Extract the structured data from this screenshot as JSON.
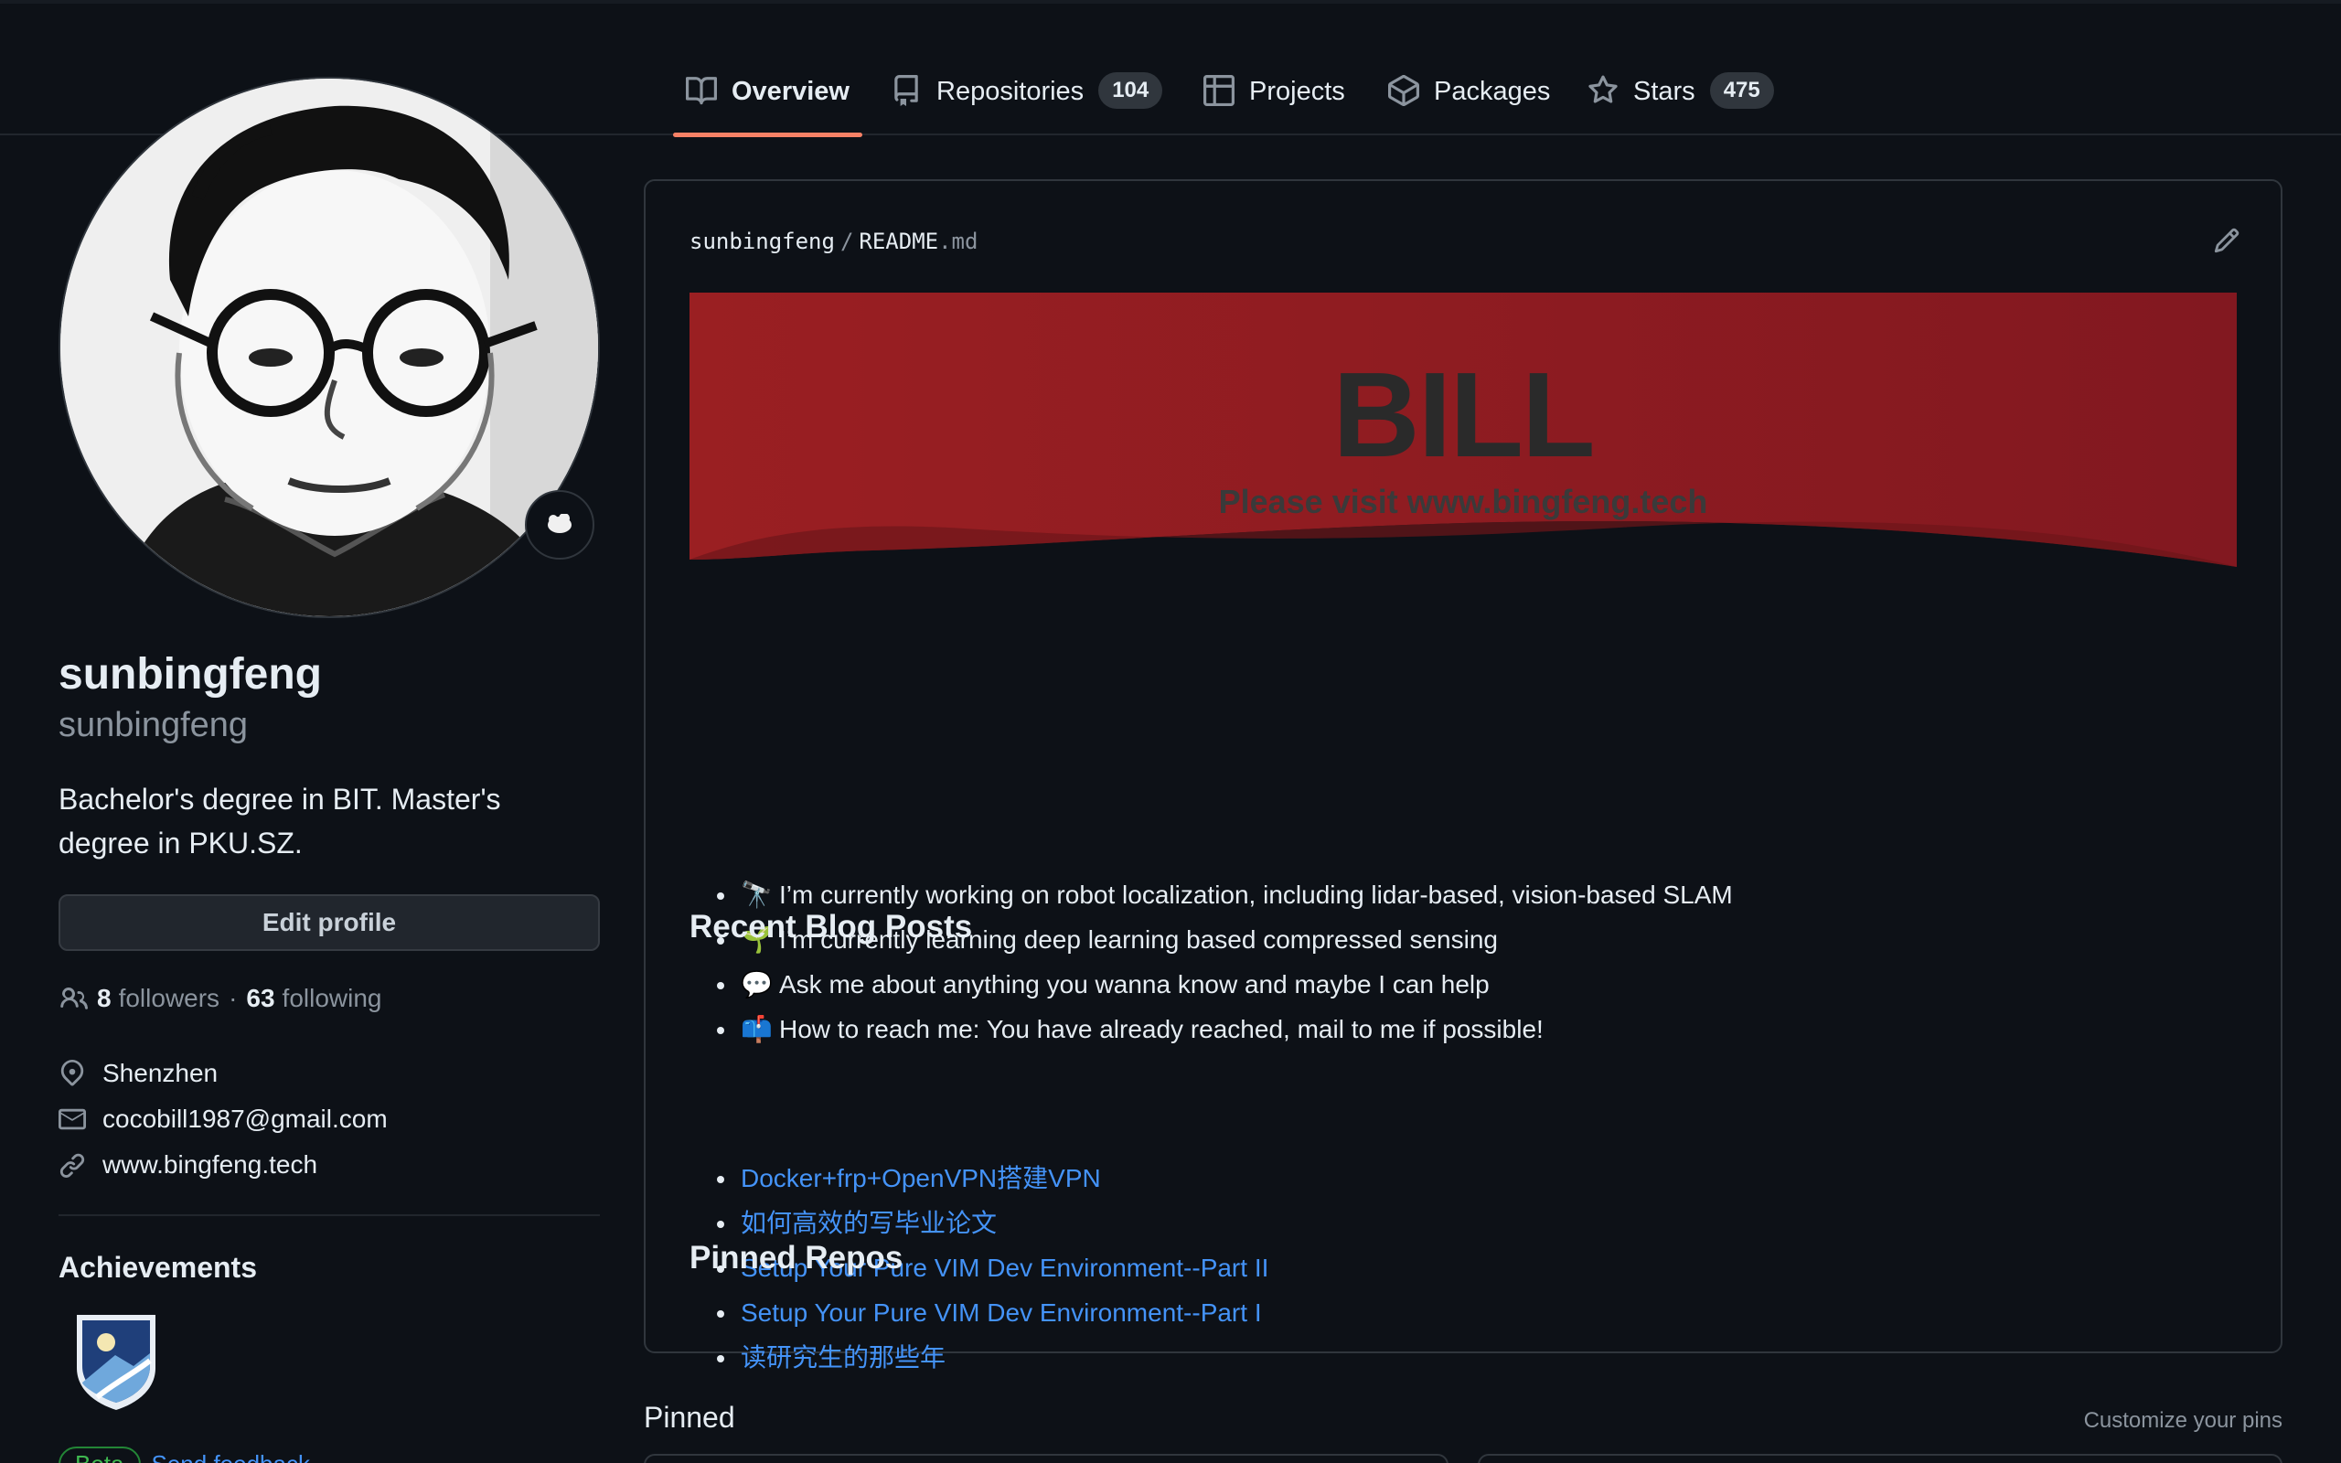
{
  "tabs": [
    {
      "label": "Overview",
      "icon": "book-icon",
      "active": true
    },
    {
      "label": "Repositories",
      "icon": "repo-icon",
      "count": "104"
    },
    {
      "label": "Projects",
      "icon": "table-icon"
    },
    {
      "label": "Packages",
      "icon": "package-icon"
    },
    {
      "label": "Stars",
      "icon": "star-icon",
      "count": "475"
    }
  ],
  "profile": {
    "display_name": "sunbingfeng",
    "username": "sunbingfeng",
    "bio": "Bachelor's degree in BIT. Master's degree in PKU.SZ.",
    "edit_label": "Edit profile",
    "followers_count": "8",
    "followers_label": "followers",
    "separator": "·",
    "following_count": "63",
    "following_label": "following",
    "location": "Shenzhen",
    "email": "cocobill1987@gmail.com",
    "website": "www.bingfeng.tech"
  },
  "achievements": {
    "title": "Achievements",
    "beta_label": "Beta",
    "feedback_link": "Send feedback"
  },
  "readme": {
    "owner": "sunbingfeng",
    "slash": "/",
    "file": "README",
    "ext": ".md",
    "banner_title": "BILL",
    "banner_subtitle": "Please visit www.bingfeng.tech",
    "bullets": [
      {
        "emoji": "🔭",
        "text": "I’m currently working on robot localization, including lidar-based, vision-based SLAM"
      },
      {
        "emoji": "🌱",
        "text": "I’m currently learning deep learning based compressed sensing"
      },
      {
        "emoji": "💬",
        "text": "Ask me about anything you wanna know and maybe I can help"
      },
      {
        "emoji": "📫",
        "text": "How to reach me: You have already reached, mail to me if possible!"
      }
    ],
    "blog_heading": "Recent Blog Posts",
    "posts": [
      "Docker+frp+OpenVPN搭建VPN",
      "如何高效的写毕业论文",
      "Setup Your Pure VIM Dev Environment--Part II",
      "Setup Your Pure VIM Dev Environment--Part I",
      "读研究生的那些年"
    ],
    "pinned_heading": "Pinned Repos"
  },
  "pinned": {
    "title": "Pinned",
    "customize": "Customize your pins"
  },
  "colors": {
    "background": "#0d1117",
    "accent_underline": "#f78166",
    "link": "#4493f8",
    "banner_red": "#8b1a1f"
  }
}
